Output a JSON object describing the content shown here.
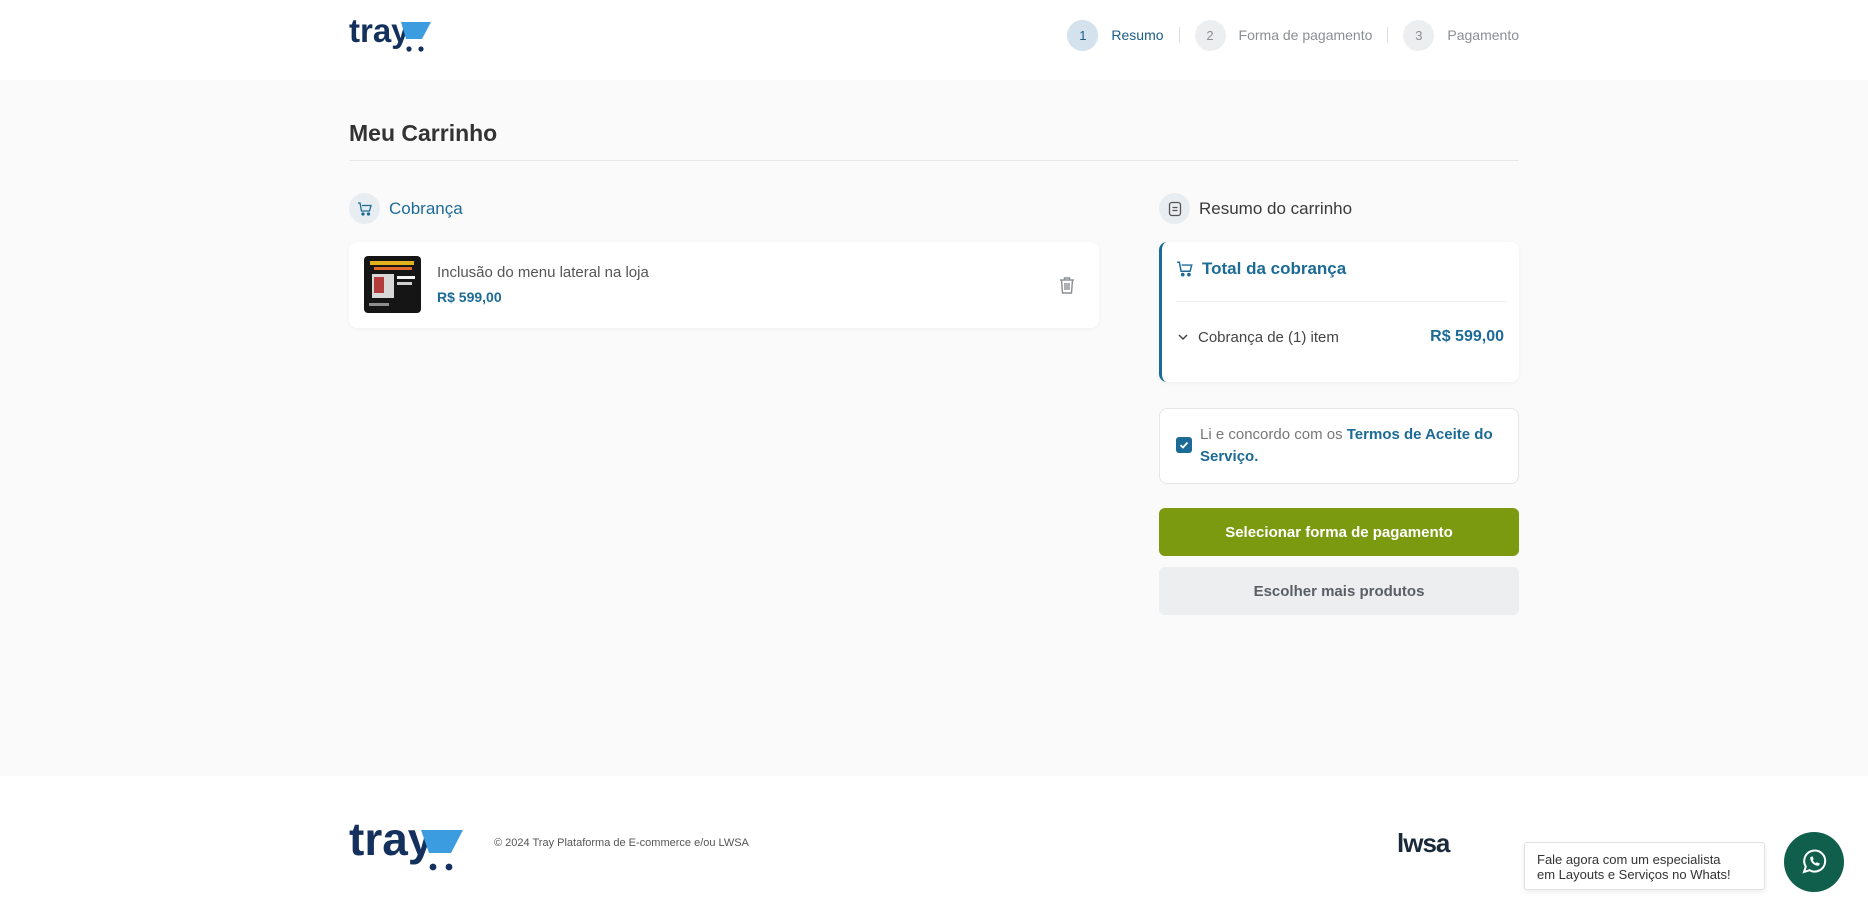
{
  "header": {
    "brand": "tray",
    "steps": [
      {
        "number": "1",
        "label": "Resumo",
        "active": true
      },
      {
        "number": "2",
        "label": "Forma de pagamento",
        "active": false
      },
      {
        "number": "3",
        "label": "Pagamento",
        "active": false
      }
    ]
  },
  "main": {
    "title": "Meu Carrinho",
    "billing": {
      "heading": "Cobrança",
      "items": [
        {
          "name": "Inclusão do menu lateral na loja",
          "price": "R$ 599,00"
        }
      ]
    },
    "summary": {
      "heading": "Resumo do carrinho",
      "total_title": "Total da cobrança",
      "charge_label": "Cobrança de (1) item",
      "charge_value": "R$ 599,00",
      "terms_prefix": "Li e concordo com os ",
      "terms_link": "Termos de Aceite do Serviço.",
      "terms_checked": true,
      "primary_button": "Selecionar forma de pagamento",
      "secondary_button": "Escolher mais produtos"
    }
  },
  "footer": {
    "brand": "tray",
    "copyright": "© 2024 Tray Plataforma de E-commerce e/ou LWSA",
    "partner_logo": "lwsa"
  },
  "whatsapp": {
    "line1": "Fale agora com um especialista",
    "line2": "em Layouts e Serviços no Whats!",
    "icon": "whatsapp-icon"
  },
  "colors": {
    "accent": "#1c6b96",
    "primary_button": "#7b9a0f",
    "whatsapp": "#0f5f4c",
    "brand_navy": "#14305c",
    "brand_blue": "#3b9ce0"
  }
}
